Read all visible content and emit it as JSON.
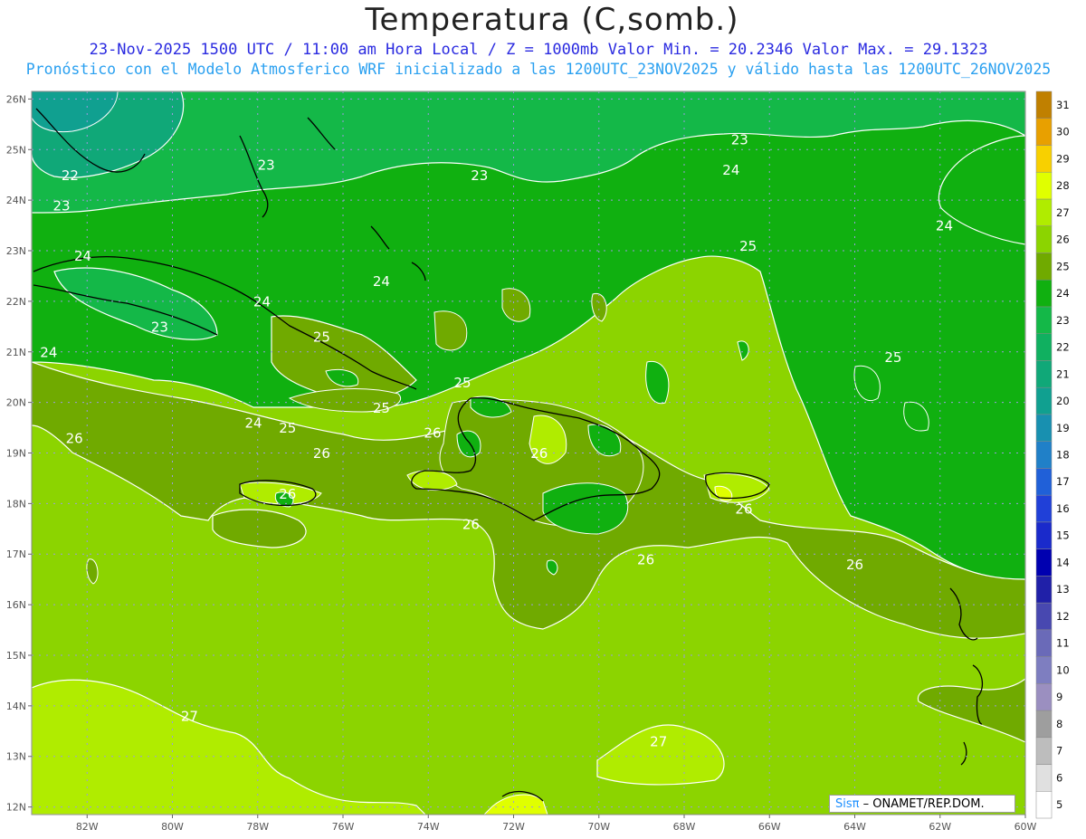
{
  "title": "Temperatura (C,somb.)",
  "subtitle_line1": "23-Nov-2025 1500 UTC / 11:00 am Hora Local / Z = 1000mb  Valor Min. = 20.2346  Valor Max. = 29.1323",
  "subtitle_line2": "Pronóstico con el Modelo Atmosferico WRF inicializado a las 1200UTC_23NOV2025 y válido hasta las  1200UTC_26NOV2025",
  "credit": {
    "brand": "Sisπ",
    "text": " – ONAMET/REP.DOM."
  },
  "lat_labels": [
    "26N",
    "25N",
    "24N",
    "23N",
    "22N",
    "21N",
    "20N",
    "19N",
    "18N",
    "17N",
    "16N",
    "15N",
    "14N",
    "13N",
    "12N"
  ],
  "lon_labels": [
    "82W",
    "80W",
    "78W",
    "76W",
    "74W",
    "72W",
    "70W",
    "68W",
    "66W",
    "64W",
    "62W",
    "60W"
  ],
  "colorbar": {
    "levels": [
      "5",
      "6",
      "7",
      "8",
      "9",
      "10",
      "11",
      "12",
      "13",
      "14",
      "15",
      "16",
      "17",
      "18",
      "19",
      "20",
      "21",
      "22",
      "23",
      "24",
      "25",
      "26",
      "27",
      "28",
      "29",
      "30",
      "31"
    ],
    "colors": [
      "#ffffff",
      "#e0e0e0",
      "#bdbdbd",
      "#9e9e9e",
      "#9b8fc0",
      "#7e7ec0",
      "#6a6ab8",
      "#4848b0",
      "#2020a8",
      "#0000b0",
      "#1a2acb",
      "#2040d8",
      "#2060d8",
      "#2080c8",
      "#1890b0",
      "#10a090",
      "#10a878",
      "#10b060",
      "#14b848",
      "#10b010",
      "#70aa00",
      "#8cd400",
      "#b0ec00",
      "#e0ff00",
      "#f8d000",
      "#e8a000",
      "#c08000"
    ]
  },
  "contour_labels": [
    {
      "text": "23",
      "lon": -66.7,
      "lat": 25.1
    },
    {
      "text": "23",
      "lon": -72.8,
      "lat": 24.4
    },
    {
      "text": "23",
      "lon": -77.8,
      "lat": 24.6
    },
    {
      "text": "22",
      "lon": -82.4,
      "lat": 24.4
    },
    {
      "text": "23",
      "lon": -82.6,
      "lat": 23.8
    },
    {
      "text": "24",
      "lon": -66.9,
      "lat": 24.5
    },
    {
      "text": "24",
      "lon": -61.9,
      "lat": 23.4
    },
    {
      "text": "24",
      "lon": -82.1,
      "lat": 22.8
    },
    {
      "text": "24",
      "lon": -75.1,
      "lat": 22.3
    },
    {
      "text": "24",
      "lon": -77.9,
      "lat": 21.9
    },
    {
      "text": "23",
      "lon": -80.3,
      "lat": 21.4
    },
    {
      "text": "24",
      "lon": -82.9,
      "lat": 20.9
    },
    {
      "text": "25",
      "lon": -66.5,
      "lat": 23.0
    },
    {
      "text": "25",
      "lon": -76.5,
      "lat": 21.2
    },
    {
      "text": "25",
      "lon": -73.2,
      "lat": 20.3
    },
    {
      "text": "25",
      "lon": -75.1,
      "lat": 19.8
    },
    {
      "text": "25",
      "lon": -77.3,
      "lat": 19.4
    },
    {
      "text": "24",
      "lon": -78.1,
      "lat": 19.5
    },
    {
      "text": "25",
      "lon": -63.1,
      "lat": 20.8
    },
    {
      "text": "26",
      "lon": -82.3,
      "lat": 19.2
    },
    {
      "text": "26",
      "lon": -76.5,
      "lat": 18.9
    },
    {
      "text": "26",
      "lon": -73.9,
      "lat": 19.3
    },
    {
      "text": "26",
      "lon": -71.4,
      "lat": 18.9
    },
    {
      "text": "26",
      "lon": -77.3,
      "lat": 18.1
    },
    {
      "text": "26",
      "lon": -73.0,
      "lat": 17.5
    },
    {
      "text": "26",
      "lon": -66.6,
      "lat": 17.8
    },
    {
      "text": "26",
      "lon": -68.9,
      "lat": 16.8
    },
    {
      "text": "26",
      "lon": -64.0,
      "lat": 16.7
    },
    {
      "text": "27",
      "lon": -79.6,
      "lat": 13.7
    },
    {
      "text": "27",
      "lon": -68.6,
      "lat": 13.2
    }
  ]
}
